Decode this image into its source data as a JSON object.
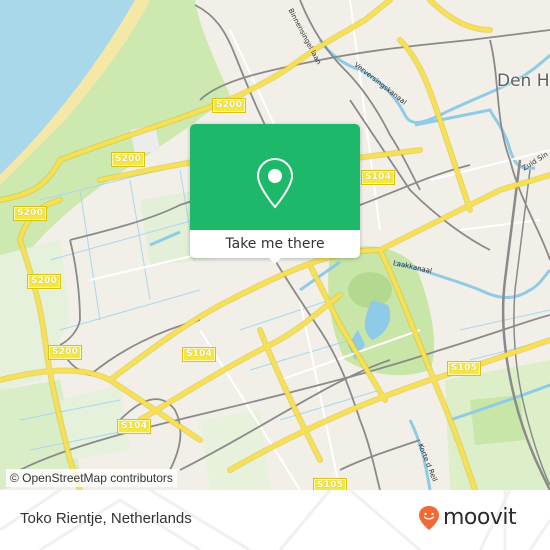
{
  "map": {
    "attribution": "© OpenStreetMap contributors",
    "place_label": "Den H",
    "road_labels": [
      {
        "id": "s200-a",
        "text": "S200"
      },
      {
        "id": "s200-b",
        "text": "S200"
      },
      {
        "id": "s200-c",
        "text": "S200"
      },
      {
        "id": "s200-d",
        "text": "S200"
      },
      {
        "id": "s200-e",
        "text": "S200"
      },
      {
        "id": "s104-a",
        "text": "S104"
      },
      {
        "id": "s104-b",
        "text": "S104"
      },
      {
        "id": "s104-c",
        "text": "S104"
      },
      {
        "id": "s105-a",
        "text": "S105"
      },
      {
        "id": "s105-b",
        "text": "S105"
      }
    ],
    "street_labels": [
      {
        "id": "verversingskanaal",
        "text": "Verversingskanaal"
      },
      {
        "id": "laakkanaal",
        "text": "Laakkanaal"
      },
      {
        "id": "zuid-singel",
        "text": "Zuid Sin"
      },
      {
        "id": "korte-raam",
        "text": "Korte d Reil"
      },
      {
        "id": "binnensingel",
        "text": "Binnensingel laan"
      }
    ],
    "colors": {
      "sea": "#a9d8ea",
      "beach": "#f5e7a6",
      "dunes": "#cde9b0",
      "land": "#f2efe9",
      "major_road": "#f7df56",
      "rail": "#8a8a8a",
      "water": "#86c9e5",
      "park": "#c8e6a8"
    }
  },
  "popup": {
    "cta_label": "Take me there",
    "accent_color": "#1db86a",
    "icon": "map-pin-icon"
  },
  "footer": {
    "place_name": "Toko Rientje, Netherlands",
    "brand": "moovit",
    "brand_color": "#f06a35"
  }
}
